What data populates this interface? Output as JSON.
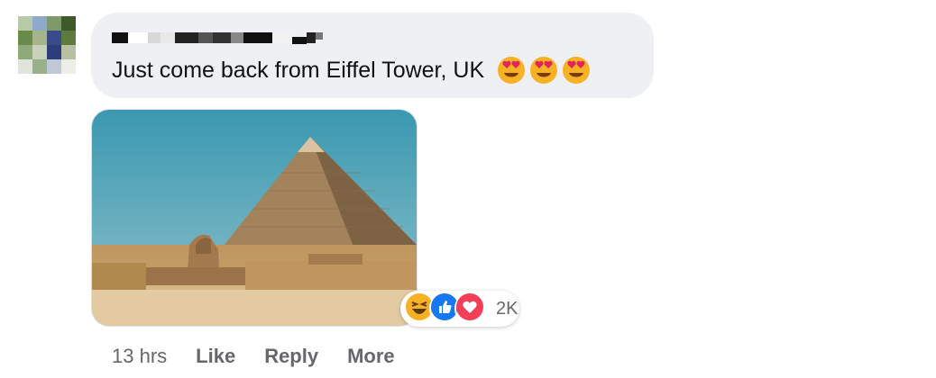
{
  "comment": {
    "text": "Just come back from Eiffel Tower, UK",
    "emojis": [
      "heart-eyes-emoji",
      "heart-eyes-emoji",
      "heart-eyes-emoji"
    ]
  },
  "reactions": {
    "icons": [
      "laughing-reaction-icon",
      "like-reaction-icon",
      "love-reaction-icon"
    ],
    "count": "2K"
  },
  "actions": {
    "timestamp": "13 hrs",
    "like_label": "Like",
    "reply_label": "Reply",
    "more_label": "More"
  },
  "colors": {
    "bubble": "#eef0f3",
    "like": "#1877f2",
    "love": "#f33e58",
    "haha": "#f7b125",
    "secondary_text": "#65676b"
  }
}
